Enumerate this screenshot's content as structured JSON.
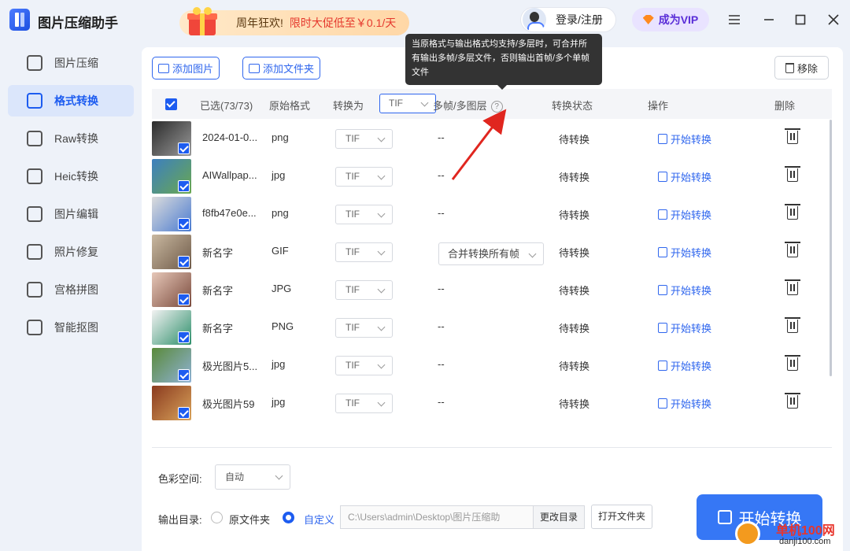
{
  "app": {
    "title": "图片压缩助手"
  },
  "promo": {
    "text_a": "周年狂欢!",
    "text_b": "限时大促低至￥0.1/天"
  },
  "header": {
    "login": "登录/注册",
    "vip": "成为VIP"
  },
  "sidebar": {
    "items": [
      {
        "label": "图片压缩",
        "icon": "image-compress-icon"
      },
      {
        "label": "格式转换",
        "icon": "format-convert-icon",
        "active": true
      },
      {
        "label": "Raw转换",
        "icon": "raw-icon"
      },
      {
        "label": "Heic转换",
        "icon": "heic-icon"
      },
      {
        "label": "图片编辑",
        "icon": "image-edit-icon"
      },
      {
        "label": "照片修复",
        "icon": "photo-repair-icon"
      },
      {
        "label": "宫格拼图",
        "icon": "grid-collage-icon"
      },
      {
        "label": "智能抠图",
        "icon": "smart-cutout-icon"
      }
    ]
  },
  "toolbar": {
    "add_image": "添加图片",
    "add_folder": "添加文件夹",
    "remove": "移除"
  },
  "table": {
    "headers": {
      "selected": "已选(73/73)",
      "orig_format": "原始格式",
      "convert_to": "转换为",
      "convert_to_value": "TIF",
      "multi_frame": "多帧/多图层",
      "status": "转换状态",
      "action": "操作",
      "delete": "删除"
    },
    "rows": [
      {
        "name": "2024-01-0...",
        "format": "png",
        "target": "TIF",
        "frames": "--",
        "status": "待转换",
        "action": "开始转换",
        "thumb": [
          "#2b2b2b",
          "#9a9a9a"
        ]
      },
      {
        "name": "AIWallpap...",
        "format": "jpg",
        "target": "TIF",
        "frames": "--",
        "status": "待转换",
        "action": "开始转换",
        "thumb": [
          "#3c7fbf",
          "#6aa84f"
        ]
      },
      {
        "name": "f8fb47e0e...",
        "format": "png",
        "target": "TIF",
        "frames": "--",
        "status": "待转换",
        "action": "开始转换",
        "thumb": [
          "#dcdcdc",
          "#4a7bd0"
        ]
      },
      {
        "name": "新名字",
        "format": "GIF",
        "target": "TIF",
        "frames": "合并转换所有帧",
        "status": "待转换",
        "action": "开始转换",
        "thumb": [
          "#c9b8a0",
          "#6e5a48"
        ]
      },
      {
        "name": "新名字",
        "format": "JPG",
        "target": "TIF",
        "frames": "--",
        "status": "待转换",
        "action": "开始转换",
        "thumb": [
          "#e6c7b8",
          "#7a4a3c"
        ]
      },
      {
        "name": "新名字",
        "format": "PNG",
        "target": "TIF",
        "frames": "--",
        "status": "待转换",
        "action": "开始转换",
        "thumb": [
          "#f2f2f2",
          "#2e8f6b"
        ]
      },
      {
        "name": "极光图片5...",
        "format": "jpg",
        "target": "TIF",
        "frames": "--",
        "status": "待转换",
        "action": "开始转换",
        "thumb": [
          "#5a8a3a",
          "#8fb2d6"
        ]
      },
      {
        "name": "极光图片59",
        "format": "jpg",
        "target": "TIF",
        "frames": "--",
        "status": "待转换",
        "action": "开始转换",
        "thumb": [
          "#8a3a1f",
          "#d9a35a"
        ]
      }
    ]
  },
  "tooltip": "当原格式与输出格式均支持/多层时，可合并所有输出多帧/多层文件，否则输出首帧/多个单帧文件",
  "bottom": {
    "color_space_label": "色彩空间:",
    "color_space_value": "自动",
    "output_label": "输出目录:",
    "opt_original": "原文件夹",
    "opt_custom": "自定义",
    "path": "C:\\Users\\admin\\Desktop\\图片压缩助",
    "change_dir": "更改目录",
    "open_folder": "打开文件夹",
    "start": "开始转换"
  },
  "watermark": {
    "t1": "单机100网",
    "t2": "danji100.com"
  }
}
